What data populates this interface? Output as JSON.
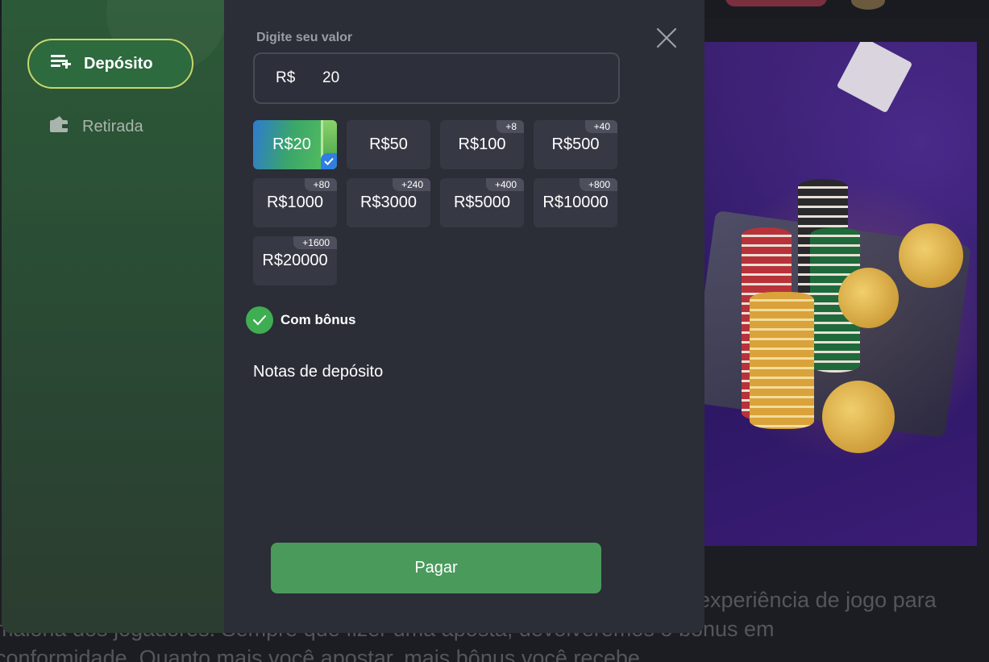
{
  "background": {
    "banner_colors": {
      "primary": "#3a1f6e",
      "secondary": "#2a1760"
    },
    "text_lines": [
      "experiência de jogo para",
      "maioria dos jogadores. Sempre que fizer uma aposta, devolveremos o bónus em",
      "conformidade. Quanto mais você apostar, mais bônus você recebe."
    ]
  },
  "sidebar": {
    "tabs": [
      {
        "label": "Depósito",
        "icon": "deposit-icon",
        "active": true
      },
      {
        "label": "Retirada",
        "icon": "wallet-icon",
        "active": false
      }
    ]
  },
  "deposit": {
    "value_label": "Digite seu valor",
    "currency": "R$",
    "amount": "20",
    "options": [
      {
        "label": "R$20",
        "bonus": "",
        "selected": true
      },
      {
        "label": "R$50",
        "bonus": "",
        "selected": false
      },
      {
        "label": "R$100",
        "bonus": "+8",
        "selected": false
      },
      {
        "label": "R$500",
        "bonus": "+40",
        "selected": false
      },
      {
        "label": "R$1000",
        "bonus": "+80",
        "selected": false
      },
      {
        "label": "R$3000",
        "bonus": "+240",
        "selected": false
      },
      {
        "label": "R$5000",
        "bonus": "+400",
        "selected": false
      },
      {
        "label": "R$10000",
        "bonus": "+800",
        "selected": false
      },
      {
        "label": "R$20000",
        "bonus": "+1600",
        "selected": false
      }
    ],
    "bonus_toggle": {
      "label": "Com bônus",
      "checked": true
    },
    "notes_title": "Notas de depósito",
    "pay_label": "Pagar"
  },
  "colors": {
    "accent_green": "#4a9a5c",
    "active_tab_border": "#c9d66a",
    "panel_bg": "#2b2d37",
    "option_bg": "#363844"
  }
}
